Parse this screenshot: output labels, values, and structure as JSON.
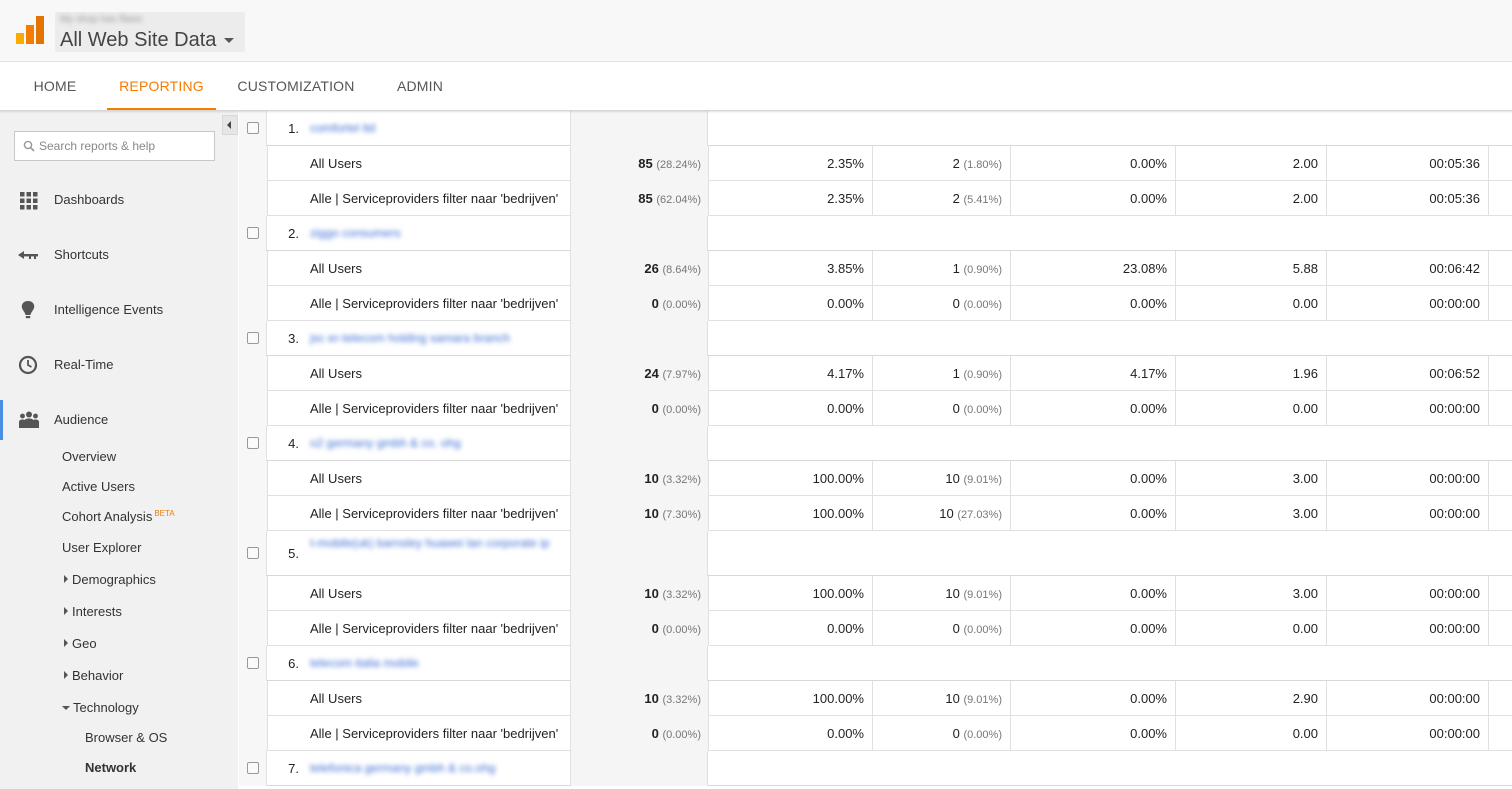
{
  "account": {
    "subtitle": "My shop has flaws",
    "title": "All Web Site Data"
  },
  "nav": {
    "tabs": [
      {
        "label": "HOME"
      },
      {
        "label": "REPORTING"
      },
      {
        "label": "CUSTOMIZATION"
      },
      {
        "label": "ADMIN"
      }
    ],
    "active": "REPORTING"
  },
  "sidebar": {
    "search_placeholder": "Search reports & help",
    "sections": [
      {
        "label": "Dashboards",
        "icon": "dashboard-grid-icon"
      },
      {
        "label": "Shortcuts",
        "icon": "shortcut-arrow-icon"
      },
      {
        "label": "Intelligence Events",
        "icon": "lightbulb-icon"
      },
      {
        "label": "Real-Time",
        "icon": "clock-icon"
      },
      {
        "label": "Audience",
        "icon": "people-icon"
      }
    ],
    "audience_items": {
      "overview": "Overview",
      "active_users": "Active Users",
      "cohort": "Cohort Analysis",
      "cohort_badge": "BETA",
      "user_explorer": "User Explorer",
      "demographics": "Demographics",
      "interests": "Interests",
      "geo": "Geo",
      "behavior": "Behavior",
      "technology": "Technology",
      "browser_os": "Browser & OS",
      "network": "Network"
    }
  },
  "table": {
    "groups": [
      {
        "index": "1.",
        "name": "comfortel ltd",
        "rows": [
          {
            "segment": "All Users",
            "sessions": "85",
            "sessions_pct": "(28.24%)",
            "new_sessions_pct": "2.35%",
            "new_users": "2",
            "new_users_pct": "(1.80%)",
            "bounce": "0.00%",
            "pages": "2.00",
            "duration": "00:05:36"
          },
          {
            "segment": "Alle | Serviceproviders filter naar 'bedrijven'",
            "sessions": "85",
            "sessions_pct": "(62.04%)",
            "new_sessions_pct": "2.35%",
            "new_users": "2",
            "new_users_pct": "(5.41%)",
            "bounce": "0.00%",
            "pages": "2.00",
            "duration": "00:05:36"
          }
        ]
      },
      {
        "index": "2.",
        "name": "ziggo consumers",
        "rows": [
          {
            "segment": "All Users",
            "sessions": "26",
            "sessions_pct": "(8.64%)",
            "new_sessions_pct": "3.85%",
            "new_users": "1",
            "new_users_pct": "(0.90%)",
            "bounce": "23.08%",
            "pages": "5.88",
            "duration": "00:06:42"
          },
          {
            "segment": "Alle | Serviceproviders filter naar 'bedrijven'",
            "sessions": "0",
            "sessions_pct": "(0.00%)",
            "new_sessions_pct": "0.00%",
            "new_users": "0",
            "new_users_pct": "(0.00%)",
            "bounce": "0.00%",
            "pages": "0.00",
            "duration": "00:00:00"
          }
        ]
      },
      {
        "index": "3.",
        "name": "jsc er-telecom holding samara branch",
        "rows": [
          {
            "segment": "All Users",
            "sessions": "24",
            "sessions_pct": "(7.97%)",
            "new_sessions_pct": "4.17%",
            "new_users": "1",
            "new_users_pct": "(0.90%)",
            "bounce": "4.17%",
            "pages": "1.96",
            "duration": "00:06:52"
          },
          {
            "segment": "Alle | Serviceproviders filter naar 'bedrijven'",
            "sessions": "0",
            "sessions_pct": "(0.00%)",
            "new_sessions_pct": "0.00%",
            "new_users": "0",
            "new_users_pct": "(0.00%)",
            "bounce": "0.00%",
            "pages": "0.00",
            "duration": "00:00:00"
          }
        ]
      },
      {
        "index": "4.",
        "name": "o2 germany gmbh & co. ohg",
        "rows": [
          {
            "segment": "All Users",
            "sessions": "10",
            "sessions_pct": "(3.32%)",
            "new_sessions_pct": "100.00%",
            "new_users": "10",
            "new_users_pct": "(9.01%)",
            "bounce": "0.00%",
            "pages": "3.00",
            "duration": "00:00:00"
          },
          {
            "segment": "Alle | Serviceproviders filter naar 'bedrijven'",
            "sessions": "10",
            "sessions_pct": "(7.30%)",
            "new_sessions_pct": "100.00%",
            "new_users": "10",
            "new_users_pct": "(27.03%)",
            "bounce": "0.00%",
            "pages": "3.00",
            "duration": "00:00:00"
          }
        ]
      },
      {
        "index": "5.",
        "name": "t-mobile(uk) barnsley huawei lan corporate ip",
        "rows": [
          {
            "segment": "All Users",
            "sessions": "10",
            "sessions_pct": "(3.32%)",
            "new_sessions_pct": "100.00%",
            "new_users": "10",
            "new_users_pct": "(9.01%)",
            "bounce": "0.00%",
            "pages": "3.00",
            "duration": "00:00:00"
          },
          {
            "segment": "Alle | Serviceproviders filter naar 'bedrijven'",
            "sessions": "0",
            "sessions_pct": "(0.00%)",
            "new_sessions_pct": "0.00%",
            "new_users": "0",
            "new_users_pct": "(0.00%)",
            "bounce": "0.00%",
            "pages": "0.00",
            "duration": "00:00:00"
          }
        ]
      },
      {
        "index": "6.",
        "name": "telecom italia mobile",
        "rows": [
          {
            "segment": "All Users",
            "sessions": "10",
            "sessions_pct": "(3.32%)",
            "new_sessions_pct": "100.00%",
            "new_users": "10",
            "new_users_pct": "(9.01%)",
            "bounce": "0.00%",
            "pages": "2.90",
            "duration": "00:00:00"
          },
          {
            "segment": "Alle | Serviceproviders filter naar 'bedrijven'",
            "sessions": "0",
            "sessions_pct": "(0.00%)",
            "new_sessions_pct": "0.00%",
            "new_users": "0",
            "new_users_pct": "(0.00%)",
            "bounce": "0.00%",
            "pages": "0.00",
            "duration": "00:00:00"
          }
        ]
      },
      {
        "index": "7.",
        "name": "telefonica germany gmbh & co.ohg",
        "rows": []
      }
    ]
  },
  "colors": {
    "accent": "#f57c00",
    "active_section": "#4a90e2",
    "link": "#3d6fd6"
  }
}
